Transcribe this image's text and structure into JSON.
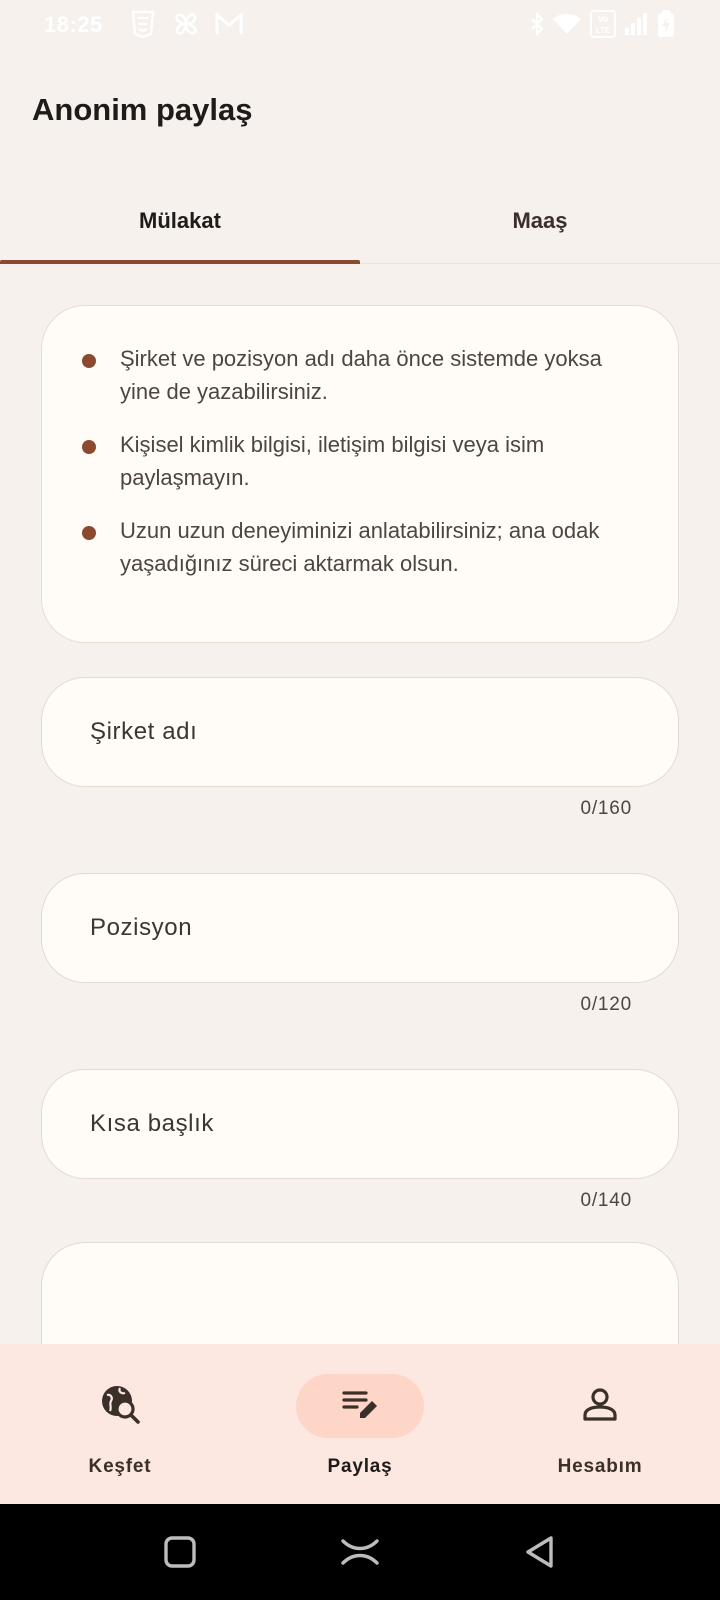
{
  "status_bar": {
    "time": "18:25",
    "left_icons": [
      "html5-icon",
      "pinwheel-icon",
      "gmail-icon"
    ],
    "right_icons": [
      "bluetooth-icon",
      "wifi-icon",
      "volte-icon",
      "signal-icon",
      "battery-charging-icon"
    ],
    "volte_label": "Vo LTE"
  },
  "header": {
    "title": "Anonim paylaş"
  },
  "tabs": [
    {
      "label": "Mülakat",
      "active": true
    },
    {
      "label": "Maaş",
      "active": false
    }
  ],
  "info": {
    "items": [
      "Şirket ve pozisyon adı daha önce sistemde yoksa yine de yazabilirsiniz.",
      "Kişisel kimlik bilgisi, iletişim bilgisi veya isim paylaşmayın.",
      "Uzun uzun deneyiminizi anlatabilirsiniz; ana odak yaşadığınız süreci aktarmak olsun."
    ]
  },
  "form": {
    "company": {
      "placeholder": "Şirket adı",
      "value": "",
      "counter": "0/160"
    },
    "position": {
      "placeholder": "Pozisyon",
      "value": "",
      "counter": "0/120"
    },
    "title": {
      "placeholder": "Kısa başlık",
      "value": "",
      "counter": "0/140"
    }
  },
  "bottom_nav": [
    {
      "label": "Keşfet",
      "icon": "explore-search-icon",
      "active": false
    },
    {
      "label": "Paylaş",
      "icon": "edit-note-icon",
      "active": true
    },
    {
      "label": "Hesabım",
      "icon": "person-icon",
      "active": false
    }
  ],
  "colors": {
    "background": "#f6f1ec",
    "accent": "#8b4a2f",
    "card": "#fffbf6",
    "nav_background": "#fde7e1",
    "nav_active_pill": "#fdd6c8"
  }
}
